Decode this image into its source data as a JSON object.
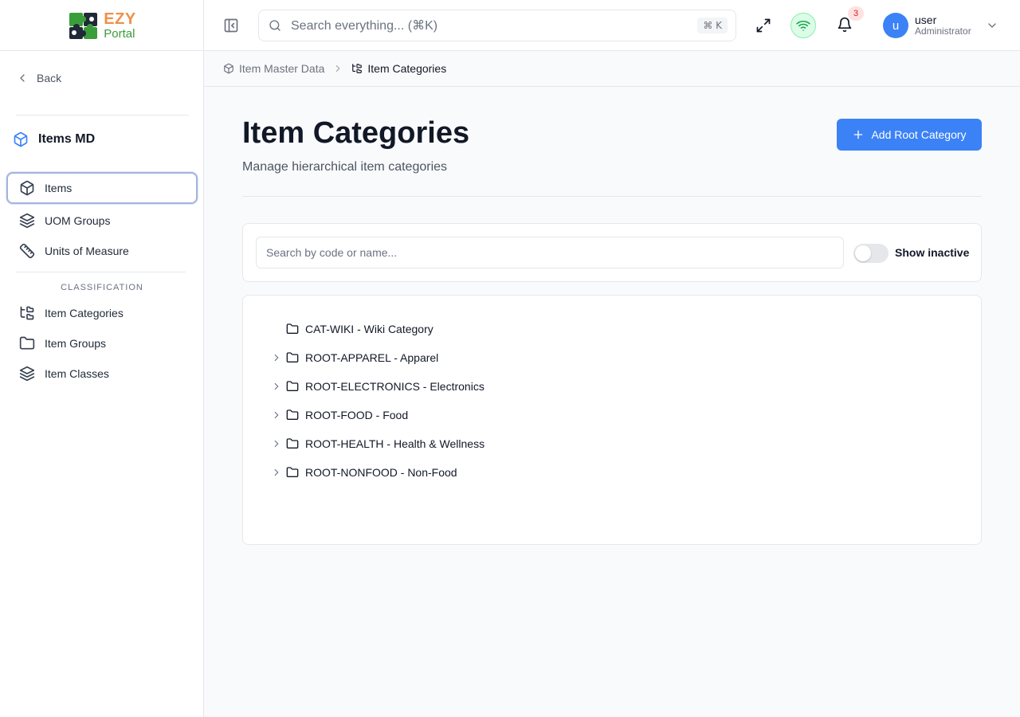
{
  "app": {
    "logo_text_top": "EZY",
    "logo_text_bottom": "Portal"
  },
  "colors": {
    "accent": "#3b82f6",
    "logo_orange": "#f0904a",
    "logo_green": "#3a9d3a",
    "badge_red": "#dc2626",
    "wifi_green": "#16a34a"
  },
  "sidebar": {
    "back_label": "Back",
    "module_title": "Items MD",
    "items": [
      {
        "label": "Items",
        "icon": "package-icon",
        "active": true
      },
      {
        "label": "UOM Groups",
        "icon": "layers-icon"
      },
      {
        "label": "Units of Measure",
        "icon": "ruler-icon"
      }
    ],
    "section_label": "CLASSIFICATION",
    "classification_items": [
      {
        "label": "Item Categories",
        "icon": "tree-icon"
      },
      {
        "label": "Item Groups",
        "icon": "folder-icon"
      },
      {
        "label": "Item Classes",
        "icon": "layers-icon"
      }
    ]
  },
  "topbar": {
    "search_placeholder": "Search everything... (⌘K)",
    "search_shortcut": "⌘ K",
    "notification_count": "3",
    "user_initial": "u",
    "user_name": "user",
    "user_role": "Administrator"
  },
  "breadcrumb": {
    "parent": "Item Master Data",
    "current": "Item Categories"
  },
  "page": {
    "title": "Item Categories",
    "subtitle": "Manage hierarchical item categories",
    "add_button": "Add Root Category"
  },
  "filters": {
    "search_placeholder": "Search by code or name...",
    "show_inactive_label": "Show inactive",
    "show_inactive": false
  },
  "tree": {
    "nodes": [
      {
        "label": "CAT-WIKI - Wiki Category",
        "expandable": false
      },
      {
        "label": "ROOT-APPAREL - Apparel",
        "expandable": true
      },
      {
        "label": "ROOT-ELECTRONICS - Electronics",
        "expandable": true
      },
      {
        "label": "ROOT-FOOD - Food",
        "expandable": true
      },
      {
        "label": "ROOT-HEALTH - Health & Wellness",
        "expandable": true
      },
      {
        "label": "ROOT-NONFOOD - Non-Food",
        "expandable": true
      }
    ]
  }
}
